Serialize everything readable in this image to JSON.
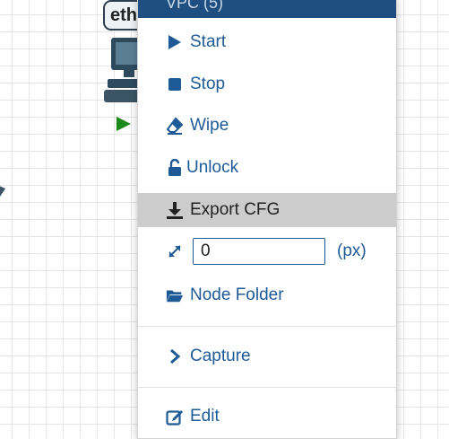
{
  "canvas": {
    "node_label": "eth",
    "node_icon": "pc-icon",
    "run_indicator": "play-triangle-icon",
    "colors": {
      "run_indicator": "#1a8a1a",
      "node_border": "#2d3e50"
    }
  },
  "menu": {
    "header": "VPC (5)",
    "items": [
      {
        "label": "Start",
        "icon": "play-icon"
      },
      {
        "label": "Stop",
        "icon": "stop-icon"
      },
      {
        "label": "Wipe",
        "icon": "eraser-icon"
      },
      {
        "label": "Unlock",
        "icon": "unlock-icon"
      },
      {
        "label": "Export CFG",
        "icon": "download-icon",
        "highlighted": true
      },
      {
        "label": "Node Folder",
        "icon": "folder-open-icon"
      },
      {
        "label": "Capture",
        "icon": "chevron-right-icon"
      },
      {
        "label": "Edit",
        "icon": "edit-icon"
      }
    ],
    "resize": {
      "value": "0",
      "unit": "(px)",
      "icon": "resize-arrows-icon"
    },
    "colors": {
      "header_bg": "#1e4f80",
      "item_text": "#1e5a96",
      "highlight_bg": "#cccccc"
    }
  }
}
